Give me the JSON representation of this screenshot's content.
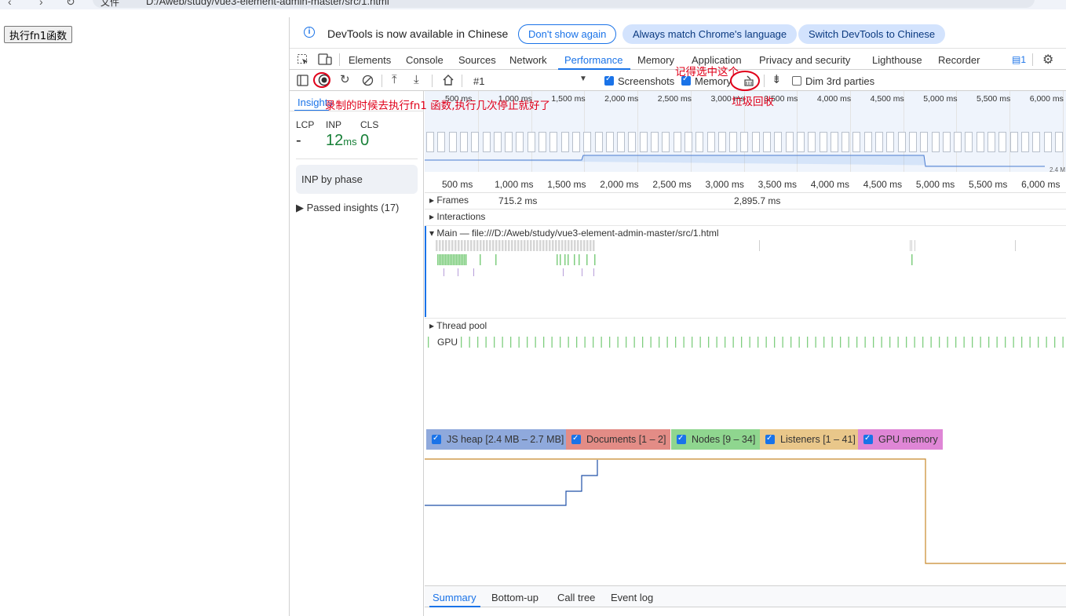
{
  "browser": {
    "url": "D:/Aweb/study/vue3-element-admin-master/src/1.html",
    "security_label": "文件"
  },
  "page": {
    "button_label": "执行fn1函数"
  },
  "devtools": {
    "infobar": {
      "message": "DevTools is now available in Chinese",
      "dont_show": "Don't show again",
      "always_match": "Always match Chrome's language",
      "switch": "Switch DevTools to Chinese"
    },
    "tabs": [
      "Elements",
      "Console",
      "Sources",
      "Network",
      "Performance",
      "Memory",
      "Application",
      "Privacy and security",
      "Lighthouse",
      "Recorder"
    ],
    "active_tab": "Performance",
    "issues_count": "1",
    "toolbar": {
      "recording": "#1",
      "screenshots": "Screenshots",
      "memory": "Memory",
      "dim_3rd": "Dim 3rd parties"
    },
    "insights": {
      "tab": "Insights",
      "lcp_label": "LCP",
      "inp_label": "INP",
      "cls_label": "CLS",
      "lcp_value": "-",
      "inp_value": "12",
      "inp_unit": "ms",
      "cls_value": "0",
      "inp_by_phase": "INP by phase",
      "passed": "Passed insights (17)"
    },
    "timeline": {
      "overview_ticks": [
        "500 ms",
        "1,000 ms",
        "1,500 ms",
        "2,000 ms",
        "2,500 ms",
        "3,000 ms",
        "3,500 ms",
        "4,000 ms",
        "4,500 ms",
        "5,000 ms",
        "5,500 ms",
        "6,000 ms"
      ],
      "overview_heap": "2.4 M",
      "main_ticks": [
        "500 ms",
        "1,000 ms",
        "1,500 ms",
        "2,000 ms",
        "2,500 ms",
        "3,000 ms",
        "3,500 ms",
        "4,000 ms",
        "4,500 ms",
        "5,000 ms",
        "5,500 ms",
        "6,000 ms"
      ],
      "frames": "Frames",
      "frame_time_1": "715.2 ms",
      "frame_time_2": "2,895.7 ms",
      "interactions": "Interactions",
      "main_thread": "Main — file:///D:/Aweb/study/vue3-element-admin-master/src/1.html",
      "thread_pool": "Thread pool",
      "gpu": "GPU"
    },
    "memory_legend": {
      "js_heap": "JS heap [2.4 MB – 2.7 MB]",
      "documents": "Documents [1 – 2]",
      "nodes": "Nodes [9 – 34]",
      "listeners": "Listeners [1 – 41]",
      "gpu_memory": "GPU memory"
    },
    "bottom_tabs": [
      "Summary",
      "Bottom-up",
      "Call tree",
      "Event log"
    ],
    "colors": {
      "accent": "#1a73e8",
      "annotation": "#e0001a"
    }
  },
  "annotations": {
    "record_note": "录制的时候去执行fn1 函数,执行几次停止就好了",
    "select_note": "记得选中这个",
    "gc_note": "垃圾回收"
  }
}
